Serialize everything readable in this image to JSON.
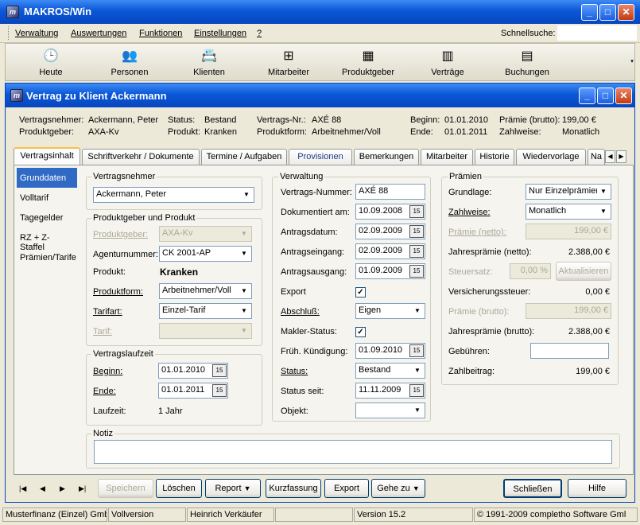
{
  "app": {
    "title": "MAKROS/Win",
    "icon": "makros-app-icon"
  },
  "menu": {
    "items": [
      "Verwaltung",
      "Auswertungen",
      "Funktionen",
      "Einstellungen",
      "?"
    ],
    "quicksearch_label": "Schnellsuche:",
    "quicksearch_value": ""
  },
  "toolbar": {
    "items": [
      {
        "label": "Heute",
        "icon": "calendar-clock-icon"
      },
      {
        "label": "Personen",
        "icon": "people-icon"
      },
      {
        "label": "Klienten",
        "icon": "client-card-icon"
      },
      {
        "label": "Mitarbeiter",
        "icon": "org-chart-icon"
      },
      {
        "label": "Produktgeber",
        "icon": "products-stack-icon"
      },
      {
        "label": "Verträge",
        "icon": "contract-chart-icon"
      },
      {
        "label": "Buchungen",
        "icon": "bookings-icon"
      }
    ]
  },
  "window": {
    "title": "Vertrag zu Klient Ackermann"
  },
  "header": {
    "vn_label": "Vertragsnehmer:",
    "vn_value": "Ackermann, Peter",
    "pg_label": "Produktgeber:",
    "pg_value": "AXA-Kv",
    "status_label": "Status:",
    "status_value": "Bestand",
    "produkt_label": "Produkt:",
    "produkt_value": "Kranken",
    "nr_label": "Vertrags-Nr.:",
    "nr_value": "AXÉ 88",
    "form_label": "Produktform:",
    "form_value": "Arbeitnehmer/Voll",
    "beginn_label": "Beginn:",
    "beginn_value": "01.01.2010",
    "ende_label": "Ende:",
    "ende_value": "01.01.2011",
    "praemie_label": "Prämie (brutto):",
    "praemie_value": "199,00 €",
    "zw_label": "Zahlweise:",
    "zw_value": "Monatlich"
  },
  "tabs": [
    "Vertragsinhalt",
    "Schriftverkehr / Dokumente",
    "Termine / Aufgaben",
    "Provisionen",
    "Bemerkungen",
    "Mitarbeiter",
    "Historie",
    "Wiedervorlage",
    "Na"
  ],
  "side": [
    "Grunddaten",
    "Volltarif",
    "Tagegelder",
    "RZ + Z-Staffel",
    "Prämien/Tarife"
  ],
  "vn": {
    "group": "Vertragsnehmer",
    "value": "Ackermann, Peter"
  },
  "pp": {
    "group": "Produktgeber und Produkt",
    "pg_label": "Produktgeber:",
    "pg_value": "AXA-Kv",
    "ag_label": "Agenturnummer:",
    "ag_value": "CK 2001-AP",
    "pr_label": "Produkt:",
    "pr_value": "Kranken",
    "pf_label": "Produktform:",
    "pf_value": "Arbeitnehmer/Voll",
    "ta_label": "Tarifart:",
    "ta_value": "Einzel-Tarif",
    "tarif_label": "Tarif:",
    "tarif_value": ""
  },
  "vl": {
    "group": "Vertragslaufzeit",
    "beginn_label": "Beginn:",
    "beginn_value": "01.01.2010",
    "ende_label": "Ende:",
    "ende_value": "01.01.2011",
    "lz_label": "Laufzeit:",
    "lz_value": "1 Jahr"
  },
  "vw": {
    "group": "Verwaltung",
    "nr_label": "Vertrags-Nummer:",
    "nr_value": "AXÉ 88",
    "dok_label": "Dokumentiert am:",
    "dok_value": "10.09.2008",
    "ad_label": "Antragsdatum:",
    "ad_value": "02.09.2009",
    "ae_label": "Antragseingang:",
    "ae_value": "02.09.2009",
    "aa_label": "Antragsausgang:",
    "aa_value": "01.09.2009",
    "ex_label": "Export",
    "ab_label": "Abschluß:",
    "ab_value": "Eigen",
    "ms_label": "Makler-Status:",
    "fk_label": "Früh. Kündigung:",
    "fk_value": "01.09.2010",
    "st_label": "Status:",
    "st_value": "Bestand",
    "ss_label": "Status seit:",
    "ss_value": "11.11.2009",
    "ob_label": "Objekt:",
    "ob_value": ""
  },
  "pm": {
    "group": "Prämien",
    "gl_label": "Grundlage:",
    "gl_value": "Nur Einzelprämien",
    "zw_label": "Zahlweise:",
    "zw_value": "Monatlich",
    "pn_label": "Prämie (netto):",
    "pn_value": "199,00 €",
    "jn_label": "Jahresprämie (netto):",
    "jn_value": "2.388,00 €",
    "ss_label": "Steuersatz:",
    "ss_value": "0,00 %",
    "akt_label": "Aktualisieren",
    "vs_label": "Versicherungssteuer:",
    "vs_value": "0,00 €",
    "pb_label": "Prämie (brutto):",
    "pb_value": "199,00 €",
    "jb_label": "Jahresprämie (brutto):",
    "jb_value": "2.388,00 €",
    "gb_label": "Gebühren:",
    "gb_value": "",
    "zb_label": "Zahlbeitrag:",
    "zb_value": "199,00 €"
  },
  "notiz": {
    "label": "Notiz",
    "value": ""
  },
  "buttons": {
    "speichern": "Speichern",
    "loeschen": "Löschen",
    "report": "Report",
    "kurz": "Kurzfassung",
    "export": "Export",
    "gehe": "Gehe zu",
    "schliessen": "Schließen",
    "hilfe": "Hilfe"
  },
  "status": {
    "s1": "Musterfinanz (Einzel) Gmb",
    "s2": "Vollversion",
    "s3": "Heinrich Verkäufer",
    "s4": "",
    "s5": "Version 15.2",
    "s6": "© 1991-2009 completho Software Gml"
  }
}
